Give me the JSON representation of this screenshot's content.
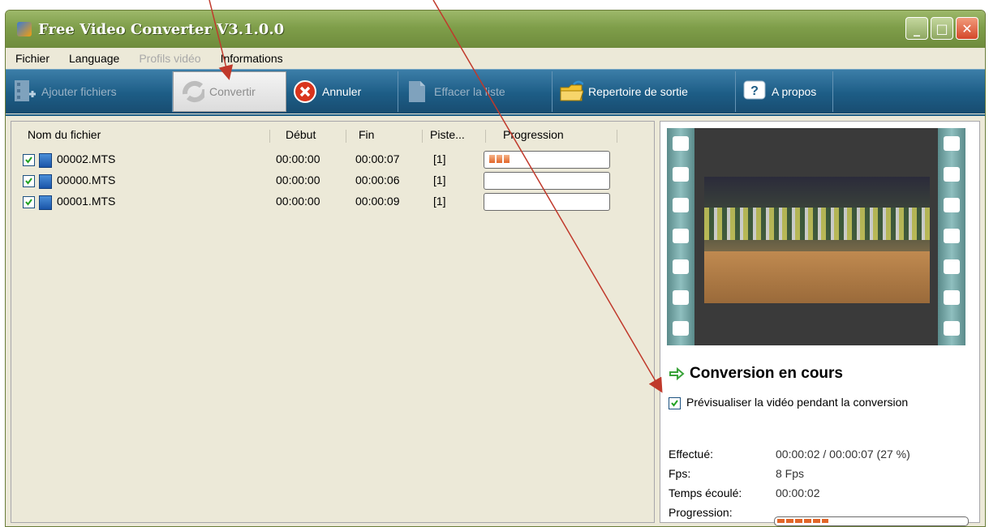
{
  "window": {
    "title": "Free Video Converter V3.1.0.0"
  },
  "menu": [
    "Fichier",
    "Language",
    "Profils vidéo",
    "Informations"
  ],
  "toolbar": {
    "add": "Ajouter fichiers",
    "convert": "Convertir",
    "cancel": "Annuler",
    "clear": "Effacer la liste",
    "output": "Repertoire de sortie",
    "about": "A propos"
  },
  "table": {
    "headers": [
      "Nom du fichier",
      "Début",
      "Fin",
      "Piste...",
      "Progression"
    ],
    "rows": [
      {
        "name": "00002.MTS",
        "start": "00:00:00",
        "end": "00:00:07",
        "track": "[1]",
        "progress_segments": 3
      },
      {
        "name": "00000.MTS",
        "start": "00:00:00",
        "end": "00:00:06",
        "track": "[1]",
        "progress_segments": 0
      },
      {
        "name": "00001.MTS",
        "start": "00:00:00",
        "end": "00:00:09",
        "track": "[1]",
        "progress_segments": 0
      }
    ]
  },
  "status": {
    "title": "Conversion en cours",
    "preview_option": "Prévisualiser la vidéo pendant la conversion",
    "done_label": "Effectué:",
    "done_value": "00:00:02 / 00:00:07  (27 %)",
    "fps_label": "Fps:",
    "fps_value": "8 Fps",
    "elapsed_label": "Temps écoulé:",
    "elapsed_value": "00:00:02",
    "progress_label": "Progression:",
    "progress_fraction": 0.27
  },
  "colors": {
    "toolbar": "#1d5d86",
    "titlebar": "#7f9e4a",
    "progress": "#e2662a",
    "annotation_arrow": "#c0392b"
  }
}
